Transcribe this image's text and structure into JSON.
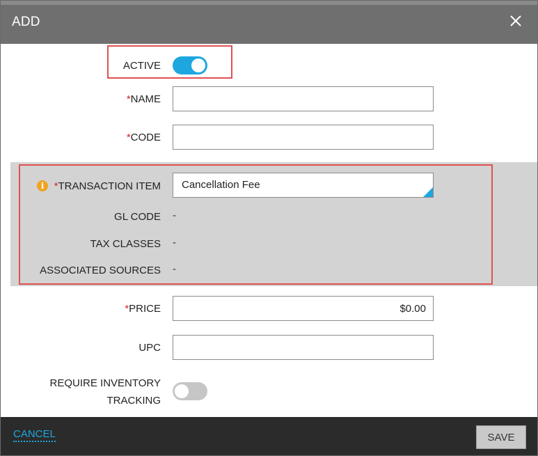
{
  "dialog": {
    "title": "ADD"
  },
  "form": {
    "active": {
      "label": "ACTIVE",
      "value": true
    },
    "name": {
      "required_mark": "*",
      "label": "NAME",
      "value": "",
      "placeholder": ""
    },
    "code": {
      "required_mark": "*",
      "label": "CODE",
      "value": "",
      "placeholder": ""
    },
    "transaction_item": {
      "required_mark": "*",
      "label": "TRANSACTION ITEM",
      "value": "Cancellation Fee"
    },
    "gl_code": {
      "label": "GL CODE",
      "value": "-"
    },
    "tax_classes": {
      "label": "TAX CLASSES",
      "value": "-"
    },
    "associated_sources": {
      "label": "ASSOCIATED SOURCES",
      "value": "-"
    },
    "price": {
      "required_mark": "*",
      "label": "PRICE",
      "value": "$0.00"
    },
    "upc": {
      "label": "UPC",
      "value": ""
    },
    "require_inventory_tracking": {
      "label_line1": "REQUIRE INVENTORY",
      "label_line2": "TRACKING",
      "value": false
    }
  },
  "footer": {
    "cancel_label": "CANCEL",
    "save_label": "SAVE"
  },
  "colors": {
    "accent": "#1ea7df",
    "required": "#d0262d",
    "highlight": "#e05050",
    "info": "#f0a321"
  },
  "icons": {
    "close": "close-icon",
    "info": "info-icon"
  }
}
